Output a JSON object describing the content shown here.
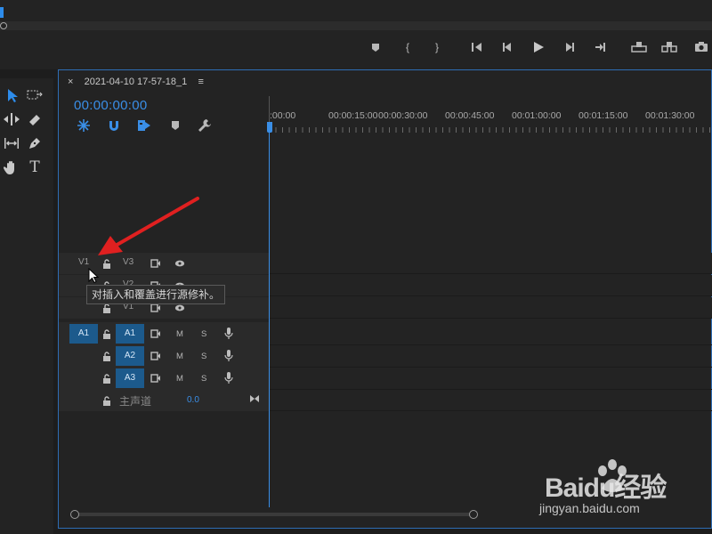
{
  "sequence": {
    "tab_close": "×",
    "tab_name": "2021-04-10 17-57-18_1",
    "tab_menu": "≡",
    "timecode": "00:00:00:00"
  },
  "ruler": {
    "labels": [
      ":00:00",
      "00:00:15:00",
      "00:00:30:00",
      "00:00:45:00",
      "00:01:00:00",
      "00:01:15:00",
      "00:01:30:00"
    ]
  },
  "tracks": {
    "video": [
      {
        "source": "V1",
        "name": "V3"
      },
      {
        "source": "",
        "name": "V2"
      },
      {
        "source": "",
        "name": "V1"
      }
    ],
    "audio": [
      {
        "source": "A1",
        "name": "A1",
        "mute": "M",
        "solo": "S"
      },
      {
        "source": "",
        "name": "A2",
        "mute": "M",
        "solo": "S"
      },
      {
        "source": "",
        "name": "A3",
        "mute": "M",
        "solo": "S"
      }
    ],
    "mix": {
      "label": "主声道",
      "value": "0.0"
    }
  },
  "tooltip": "对插入和覆盖进行源修补。",
  "watermark": {
    "brand": "Baidu经验",
    "url": "jingyan.baidu.com"
  },
  "colors": {
    "accent": "#3a8ee6",
    "target": "#1c5a8c",
    "arrow": "#e02020"
  }
}
